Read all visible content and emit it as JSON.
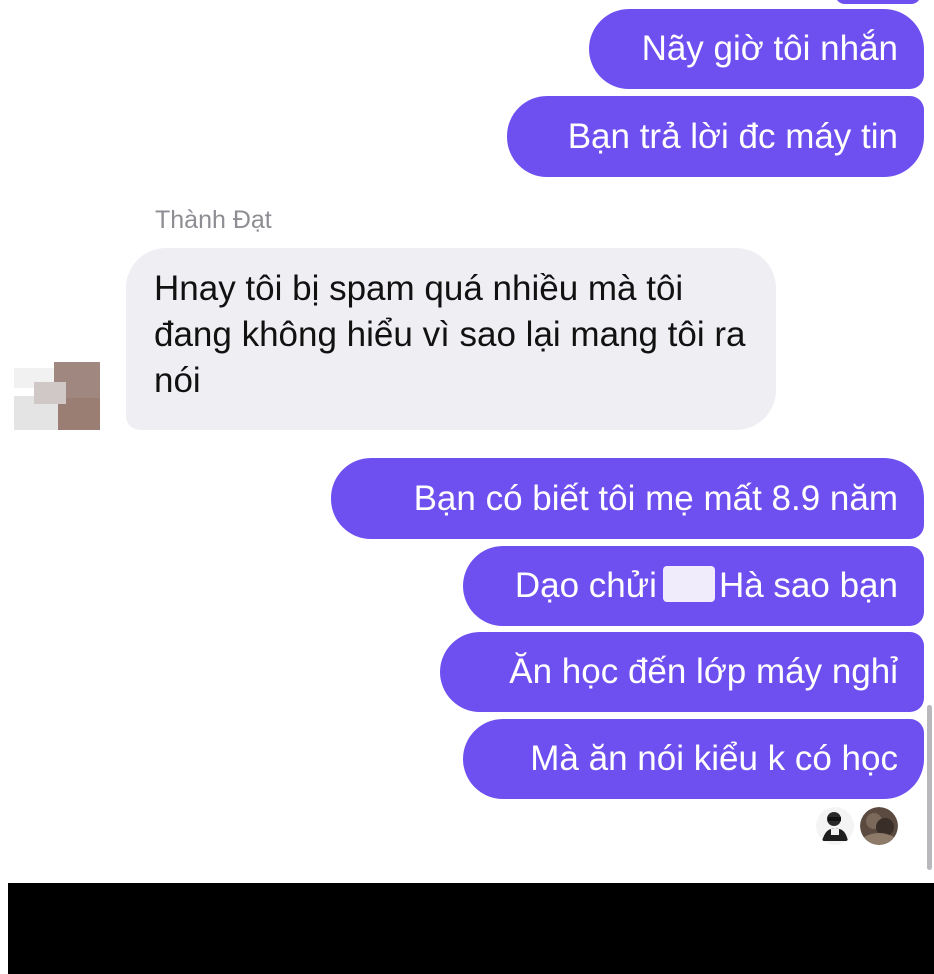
{
  "conversation": {
    "sender_name": "Thành Đạt",
    "outgoing_top": [
      {
        "text": "Nãy giờ tôi nhắn"
      },
      {
        "text": "Bạn trả lời đc máy tin"
      }
    ],
    "incoming": [
      {
        "text": "Hnay tôi bị spam quá nhiều mà tôi đang không hiểu vì sao lại mang tôi ra nói"
      }
    ],
    "outgoing_bottom": [
      {
        "text": "Bạn có biết tôi mẹ mất 8.9 năm"
      },
      {
        "text_before": "Dạo chửi",
        "text_after": "Hà sao bạn"
      },
      {
        "text": "Ăn học đến lớp máy nghỉ"
      },
      {
        "text": "Mà ăn nói kiểu k có học"
      }
    ]
  },
  "theme": {
    "outgoing_bubble_color": "#6e4ff0",
    "incoming_bubble_color": "#efeef3",
    "outgoing_text_color": "#ffffff",
    "incoming_text_color": "#111111"
  },
  "icons": {
    "avatar": "blurred-avatar-icon",
    "read_receipts": [
      "seen-avatar-icon",
      "seen-avatar-icon"
    ]
  }
}
